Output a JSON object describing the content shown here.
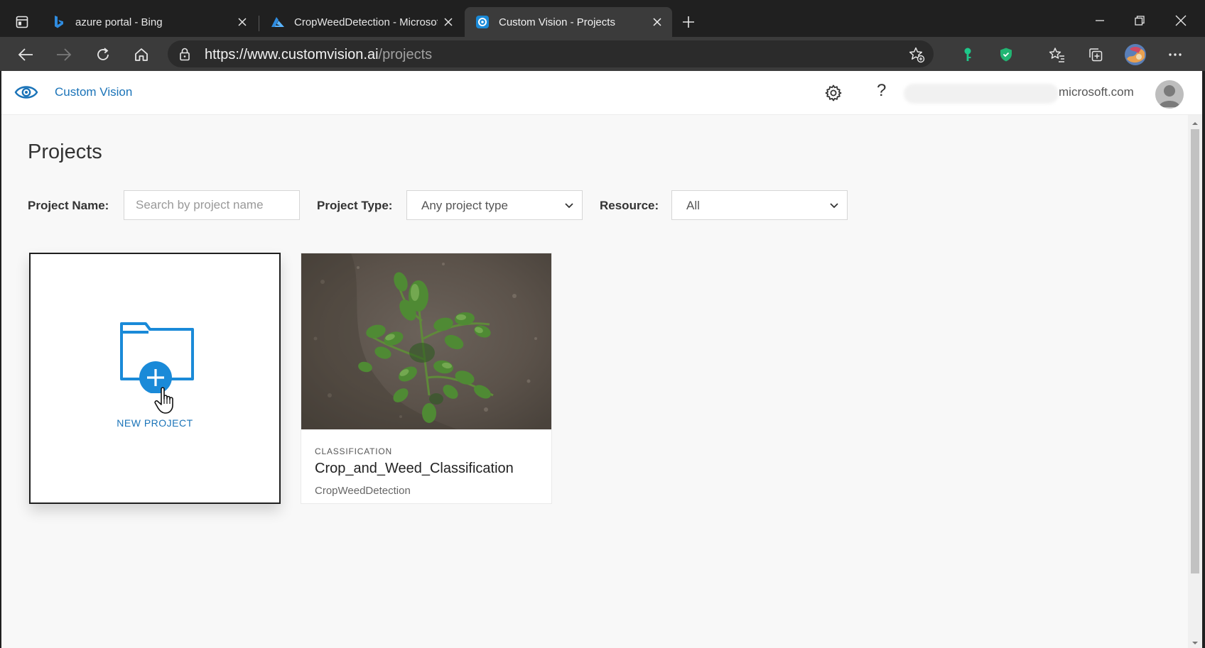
{
  "browser": {
    "tabs": [
      {
        "title": "azure portal - Bing",
        "icon": "bing-icon",
        "active": false
      },
      {
        "title": "CropWeedDetection - Microsoft",
        "icon": "azure-icon",
        "active": false
      },
      {
        "title": "Custom Vision - Projects",
        "icon": "custom-vision-icon",
        "active": true
      }
    ],
    "url": {
      "scheme": "https://",
      "host": "www.customvision.ai",
      "path": "/projects"
    }
  },
  "app": {
    "name": "Custom Vision",
    "help_glyph": "?",
    "account_domain": "microsoft.com",
    "accent_color": "#1a73b8"
  },
  "page": {
    "title": "Projects",
    "filters": {
      "name_label": "Project Name:",
      "name_placeholder": "Search by project name",
      "type_label": "Project Type:",
      "type_value": "Any project type",
      "resource_label": "Resource:",
      "resource_value": "All"
    },
    "new_project_label": "NEW PROJECT",
    "projects": [
      {
        "type": "CLASSIFICATION",
        "name": "Crop_and_Weed_Classification",
        "resource": "CropWeedDetection"
      }
    ]
  }
}
